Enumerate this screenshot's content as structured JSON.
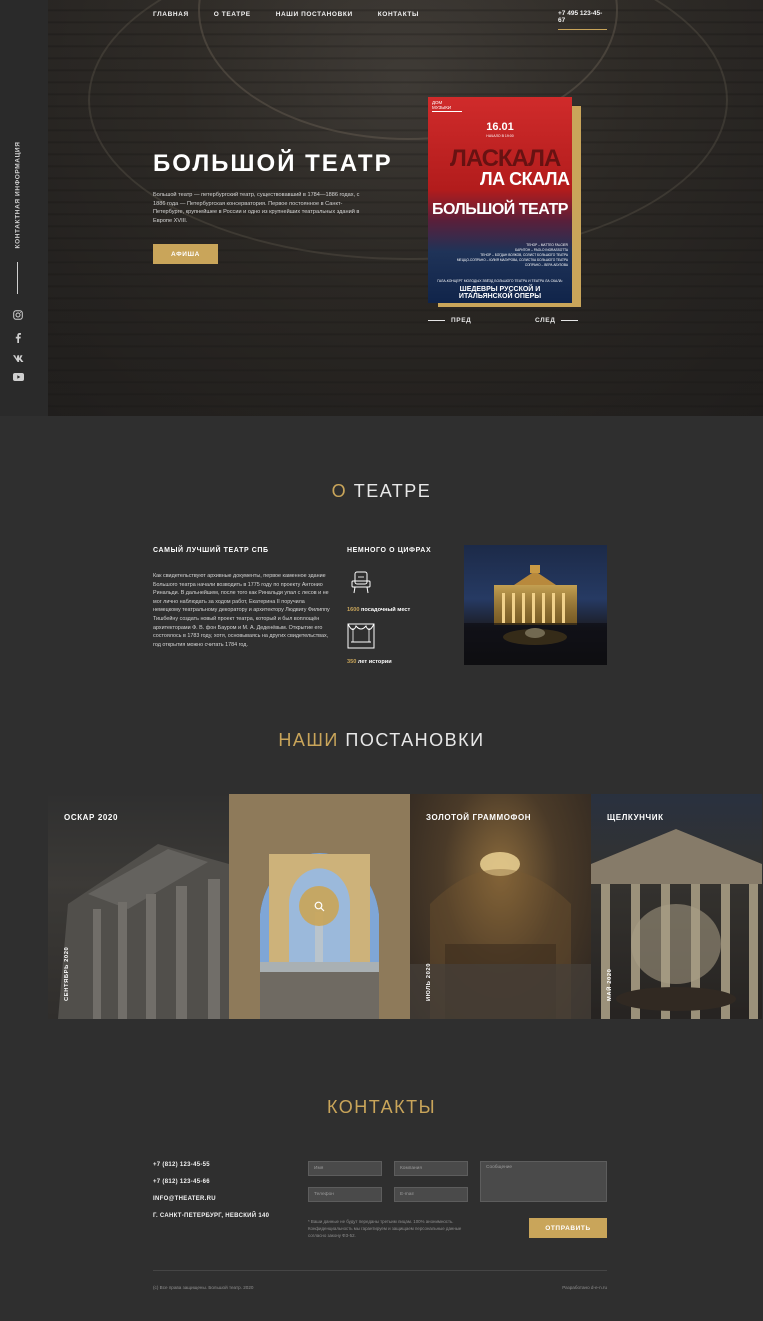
{
  "colors": {
    "accent": "#c9a55a",
    "background": "#2f2f2f",
    "text": "#ffffff"
  },
  "sidebar": {
    "label": "Контактная информация",
    "icons": [
      "instagram-icon",
      "facebook-icon",
      "vk-icon",
      "youtube-icon"
    ]
  },
  "nav": {
    "items": [
      "Главная",
      "О театре",
      "Наши постановки",
      "Контакты"
    ],
    "phone": "+7 495 123-45-67"
  },
  "hero": {
    "title": "Большой театр",
    "text": "Большой театр — петербургский театр, существовавший в 1784—1886 годах, с 1886 года — Петербургская консерватория. Первое постоянное в Санкт-Петербурге, крупнейшее в России и одно из крупнейших театральных зданий в Европе XVIII.",
    "button": "Афиша",
    "prev": "Пред",
    "next": "След",
    "poster": {
      "logo": "ДОМ МУЗЫКИ",
      "date": "16.01",
      "time": "НАЧАЛО В 19:00",
      "ghost": "ЛАСКАЛА",
      "headline1": "ЛА СКАЛА",
      "headline2": "БОЛЬШОЙ ТЕАТР",
      "cast": "ТЕНОР – MATTEO FALCIER\nБАРИТОН – PAOLO INGRASSOTTA\nТЕНОР – БОГДАН ВОЛКОВ, СОЛИСТ БОЛЬШОГО ТЕАТРА\nМЕЦЦО-СОПРАНО – ЮЛИЯ МАЗУРОВА, СОЛИСТКА БОЛЬШОГО ТЕАТРА\nСОПРАНО – ВЕРА АБУЗОВА",
      "concert": "ГАЛА-КОНЦЕРТ МОЛОДЫХ ЗВЁЗД БОЛЬШОГО ТЕАТРА И ТЕАТРА ЛА СКАЛА:",
      "subtitle": "ШЕДЕВРЫ РУССКОЙ И ИТАЛЬЯНСКОЙ ОПЕРЫ"
    }
  },
  "about": {
    "title_accent": "О",
    "title_rest": "театре",
    "left_heading": "Самый лучший театр СПб",
    "text": "Как свидетельствуют архивные документы, первое каменное здание Большого театра начали возводить в 1775 году по проекту Антонио Ринальди. В дальнейшем, после того как Ринальди упал с лесов и не мог лично наблюдать за ходом работ, Екатерина II поручила немецкому театральному декоратору и архитектору Людвигу Филиппу Тишбейну создать новый проект театра, который и был воплощён архитекторами Ф. В. фон Бауром и М. А. Деденёвым. Открытие его состоялось в 1783 году, хотя, основываясь на других свидетельствах, год открытия можно считать 1784 год.",
    "numbers_heading": "Немного о цифрах",
    "stats": [
      {
        "num": "1600",
        "label": "посадочный мест"
      },
      {
        "num": "350",
        "label": "лет истории"
      }
    ]
  },
  "shows": {
    "title_accent": "Наши",
    "title_rest": "постановки",
    "cards": [
      {
        "title": "Оскар 2020",
        "date": "Сентябрь 2020"
      },
      {
        "title": "",
        "date": ""
      },
      {
        "title": "Золотой граммофон",
        "date": "Июль 2020"
      },
      {
        "title": "Щелкунчик",
        "date": "Май 2020"
      }
    ]
  },
  "contacts": {
    "title": "Контакты",
    "phone1": "+7 (812) 123-45-55",
    "phone2": "+7 (812) 123-45-66",
    "email": "INFO@THEATER.RU",
    "address": "г. Санкт-Петербург, Невский 140",
    "placeholders": {
      "name": "Имя",
      "company": "Компания",
      "message": "Сообщение",
      "phone": "Телефон",
      "email": "E-mail"
    },
    "consent": "* Ваши данные не будут переданы третьим лицам. 100% анонимность. Конфиденциальность мы гарантируем и защищаем персональные данные согласно закону ФЗ-52.",
    "button": "Отправить"
  },
  "footer": {
    "copyright": "(c) Все права защищены. Большой театр. 2020",
    "developer": "Разработано d-e-n.ru"
  }
}
